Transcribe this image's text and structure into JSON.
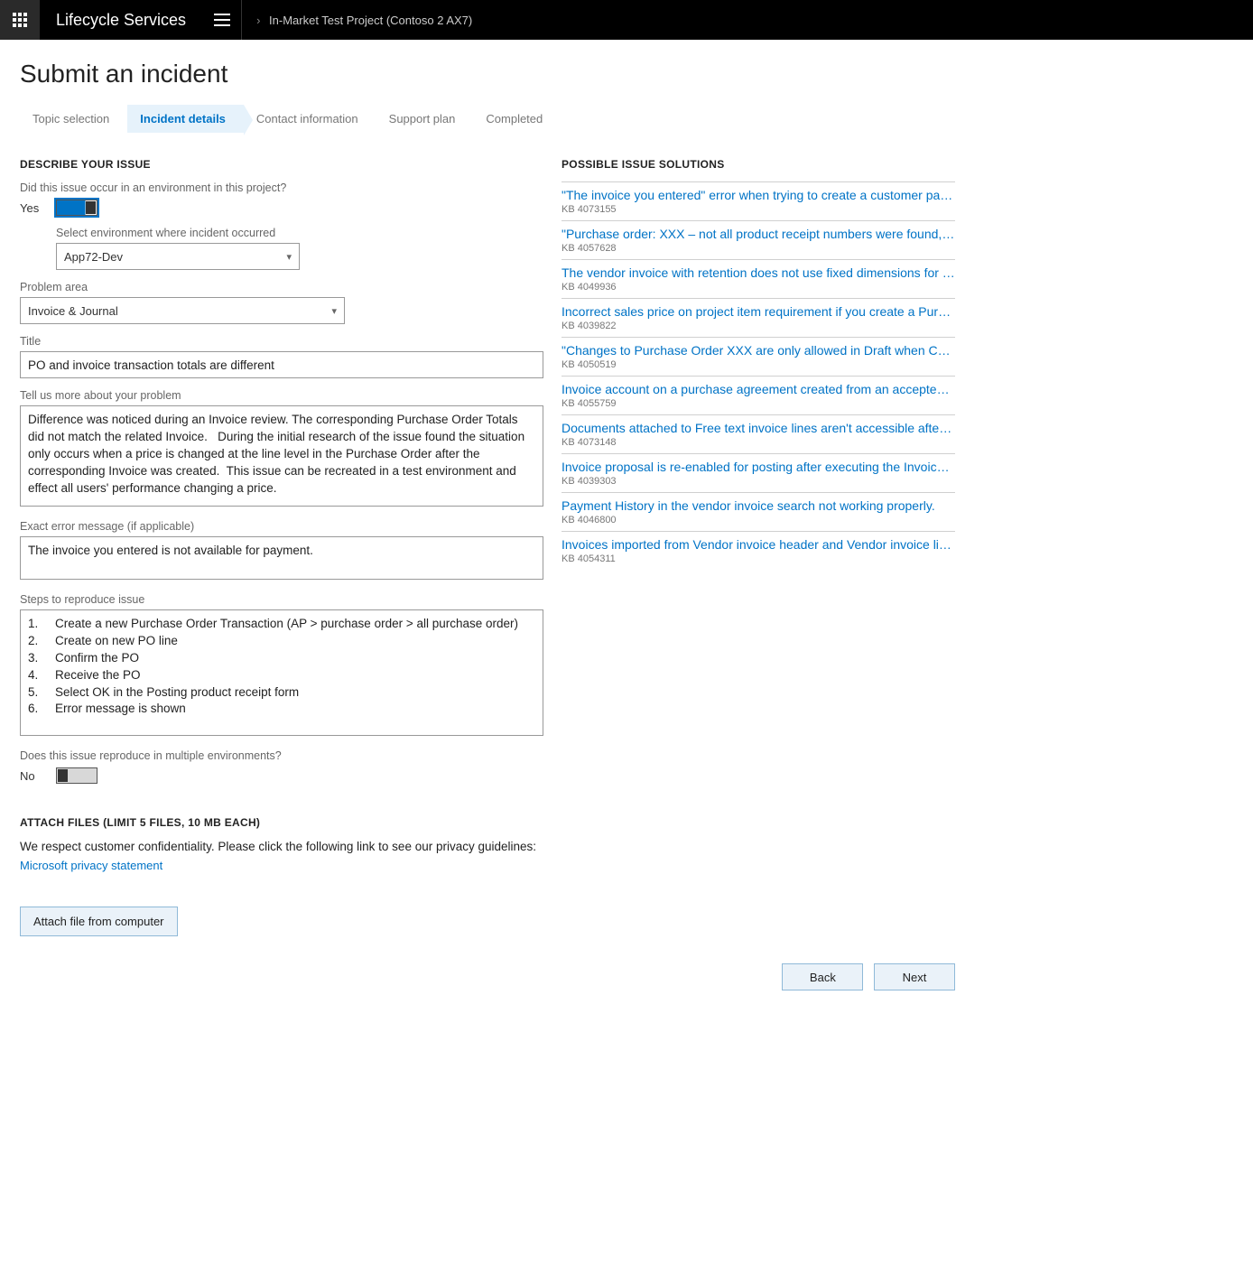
{
  "header": {
    "app_title": "Lifecycle Services",
    "breadcrumb": "In-Market Test Project (Contoso 2 AX7)"
  },
  "page": {
    "title": "Submit an incident"
  },
  "steps": {
    "topic": "Topic selection",
    "details": "Incident details",
    "contact": "Contact information",
    "plan": "Support plan",
    "completed": "Completed"
  },
  "describe": {
    "section": "DESCRIBE YOUR ISSUE",
    "env_q": "Did this issue occur in an environment in this project?",
    "env_state": "Yes",
    "select_env_label": "Select environment where incident occurred",
    "select_env_value": "App72-Dev",
    "problem_area_label": "Problem area",
    "problem_area_value": "Invoice & Journal",
    "title_label": "Title",
    "title_value": "PO and invoice transaction totals are different",
    "tell_label": "Tell us more about your problem",
    "tell_value": "Difference was noticed during an Invoice review. The corresponding Purchase Order Totals did not match the related Invoice.   During the initial research of the issue found the situation only occurs when a price is changed at the line level in the Purchase Order after the corresponding Invoice was created.  This issue can be recreated in a test environment and effect all users' performance changing a price.",
    "error_label": "Exact error message (if applicable)",
    "error_value": "The invoice you entered is not available for payment.",
    "steps_label": "Steps to reproduce issue",
    "steps_value": "1.     Create a new Purchase Order Transaction (AP > purchase order > all purchase order)\n2.     Create on new PO line\n3.     Confirm the PO\n4.     Receive the PO\n5.     Select OK in the Posting product receipt form\n6.     Error message is shown",
    "repro_label": "Does this issue reproduce in multiple environments?",
    "repro_state": "No"
  },
  "attach": {
    "section": "ATTACH FILES (LIMIT 5 FILES, 10 MB EACH)",
    "guideline": "We respect customer confidentiality. Please click the following link to see our privacy guidelines:",
    "privacy_link": "Microsoft privacy statement",
    "button": "Attach file from computer"
  },
  "solutions": {
    "section": "POSSIBLE ISSUE SOLUTIONS",
    "items": [
      {
        "title": "\"The invoice you entered\" error when trying to create a customer payment for …",
        "kb": "KB 4073155"
      },
      {
        "title": "\"Purchase order: XXX – not all product receipt numbers were found, invoice po…",
        "kb": "KB 4057628"
      },
      {
        "title": "The vendor invoice with retention does not use fixed dimensions for the retenti…",
        "kb": "KB 4049936"
      },
      {
        "title": "Incorrect sales price on project item requirement if you create a Purchase order…",
        "kb": "KB 4039822"
      },
      {
        "title": "\"Changes to Purchase Order XXX are only allowed in Draft when Change Mana…",
        "kb": "KB 4050519"
      },
      {
        "title": "Invoice account on a purchase agreement created from an accepted RFQ does…",
        "kb": "KB 4055759"
      },
      {
        "title": "Documents attached to Free text invoice lines aren't accessible after the invoice…",
        "kb": "KB 4073148"
      },
      {
        "title": "Invoice proposal is re-enabled for posting after executing the Invoice cancellati…",
        "kb": "KB 4039303"
      },
      {
        "title": "Payment History in the vendor invoice search not working properly.",
        "kb": "KB 4046800"
      },
      {
        "title": "Invoices imported from Vendor invoice header and Vendor invoice line Data en…",
        "kb": "KB 4054311"
      }
    ]
  },
  "nav": {
    "back": "Back",
    "next": "Next"
  }
}
